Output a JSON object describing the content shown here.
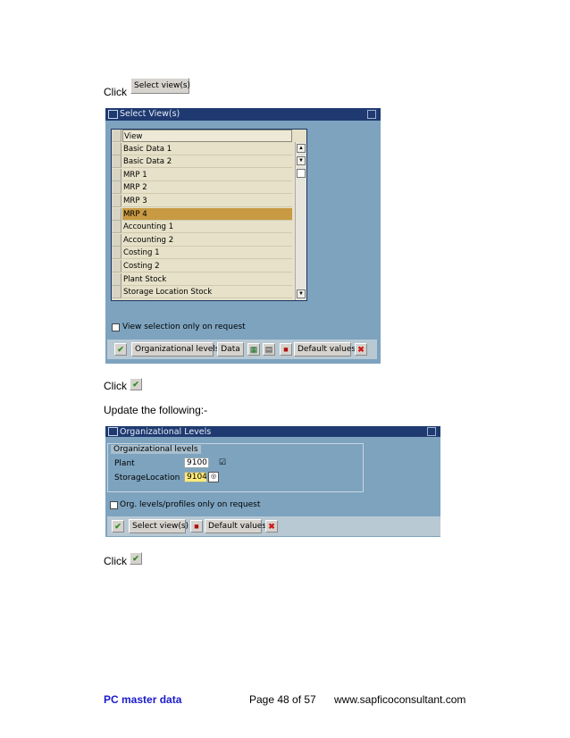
{
  "steps": {
    "click1_label": "Click",
    "select_views_button": "Select view(s)",
    "click2_label": "Click",
    "update_text": "Update the following:-",
    "click3_label": "Click"
  },
  "select_views_dialog": {
    "title": "Select View(s)",
    "column_header": "View",
    "rows": [
      "Basic Data 1",
      "Basic Data 2",
      "MRP 1",
      "MRP 2",
      "MRP 3",
      "MRP 4",
      "Accounting 1",
      "Accounting 2",
      "Costing 1",
      "Costing 2",
      "Plant Stock",
      "Storage Location Stock"
    ],
    "highlighted_row": "MRP 4",
    "option_label": "View selection only on request",
    "buttons": {
      "org_levels": "Organizational levels",
      "data": "Data",
      "default_values": "Default values"
    }
  },
  "org_levels_dialog": {
    "title": "Organizational Levels",
    "group_label": "Organizational levels",
    "plant_label": "Plant",
    "plant_value": "9100",
    "storage_label": "StorageLocation",
    "storage_value": "9104",
    "option_label": "Org. levels/profiles only on request",
    "buttons": {
      "select_views": "Select view(s)",
      "default_values": "Default values"
    }
  },
  "footer": {
    "left": "PC master data",
    "center": "Page 48 of 57",
    "right": "www.sapficoconsultant.com"
  },
  "colors": {
    "title_bar": "#1f3a70",
    "window_body": "#7da3bf",
    "highlight": "#c79a43",
    "footer_left": "#1a1acc"
  }
}
